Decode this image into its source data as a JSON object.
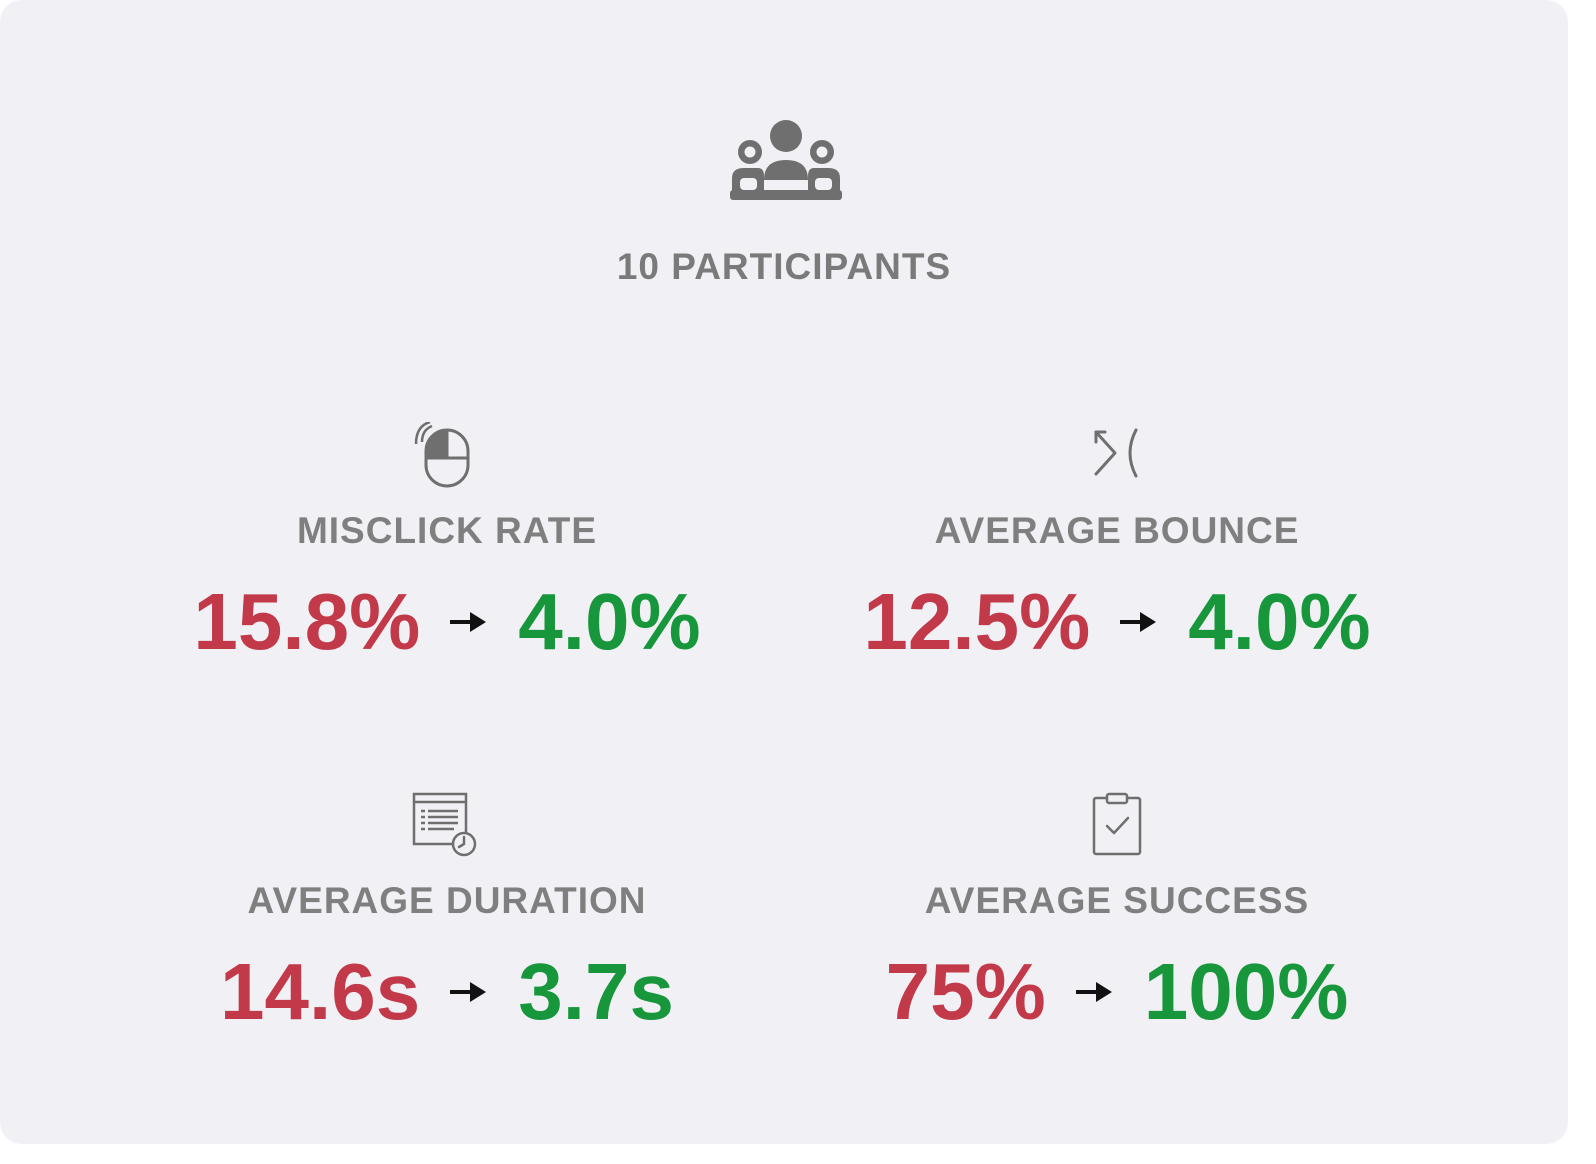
{
  "summary": {
    "participants_label": "10 PARTICIPANTS",
    "icon": "participants-group-icon"
  },
  "metrics": [
    {
      "label": "MISCLICK RATE",
      "before": "15.8%",
      "after": "4.0%",
      "icon": "mouse-click-icon"
    },
    {
      "label": "AVERAGE BOUNCE",
      "before": "12.5%",
      "after": "4.0%",
      "icon": "bounce-icon"
    },
    {
      "label": "AVERAGE DURATION",
      "before": "14.6s",
      "after": "3.7s",
      "icon": "duration-clock-icon"
    },
    {
      "label": "AVERAGE SUCCESS",
      "before": "75%",
      "after": "100%",
      "icon": "clipboard-check-icon"
    }
  ],
  "colors": {
    "background": "#f1f1f5",
    "label": "#7f7f7f",
    "before": "#c23a4a",
    "after": "#17963b",
    "arrow": "#111111"
  }
}
